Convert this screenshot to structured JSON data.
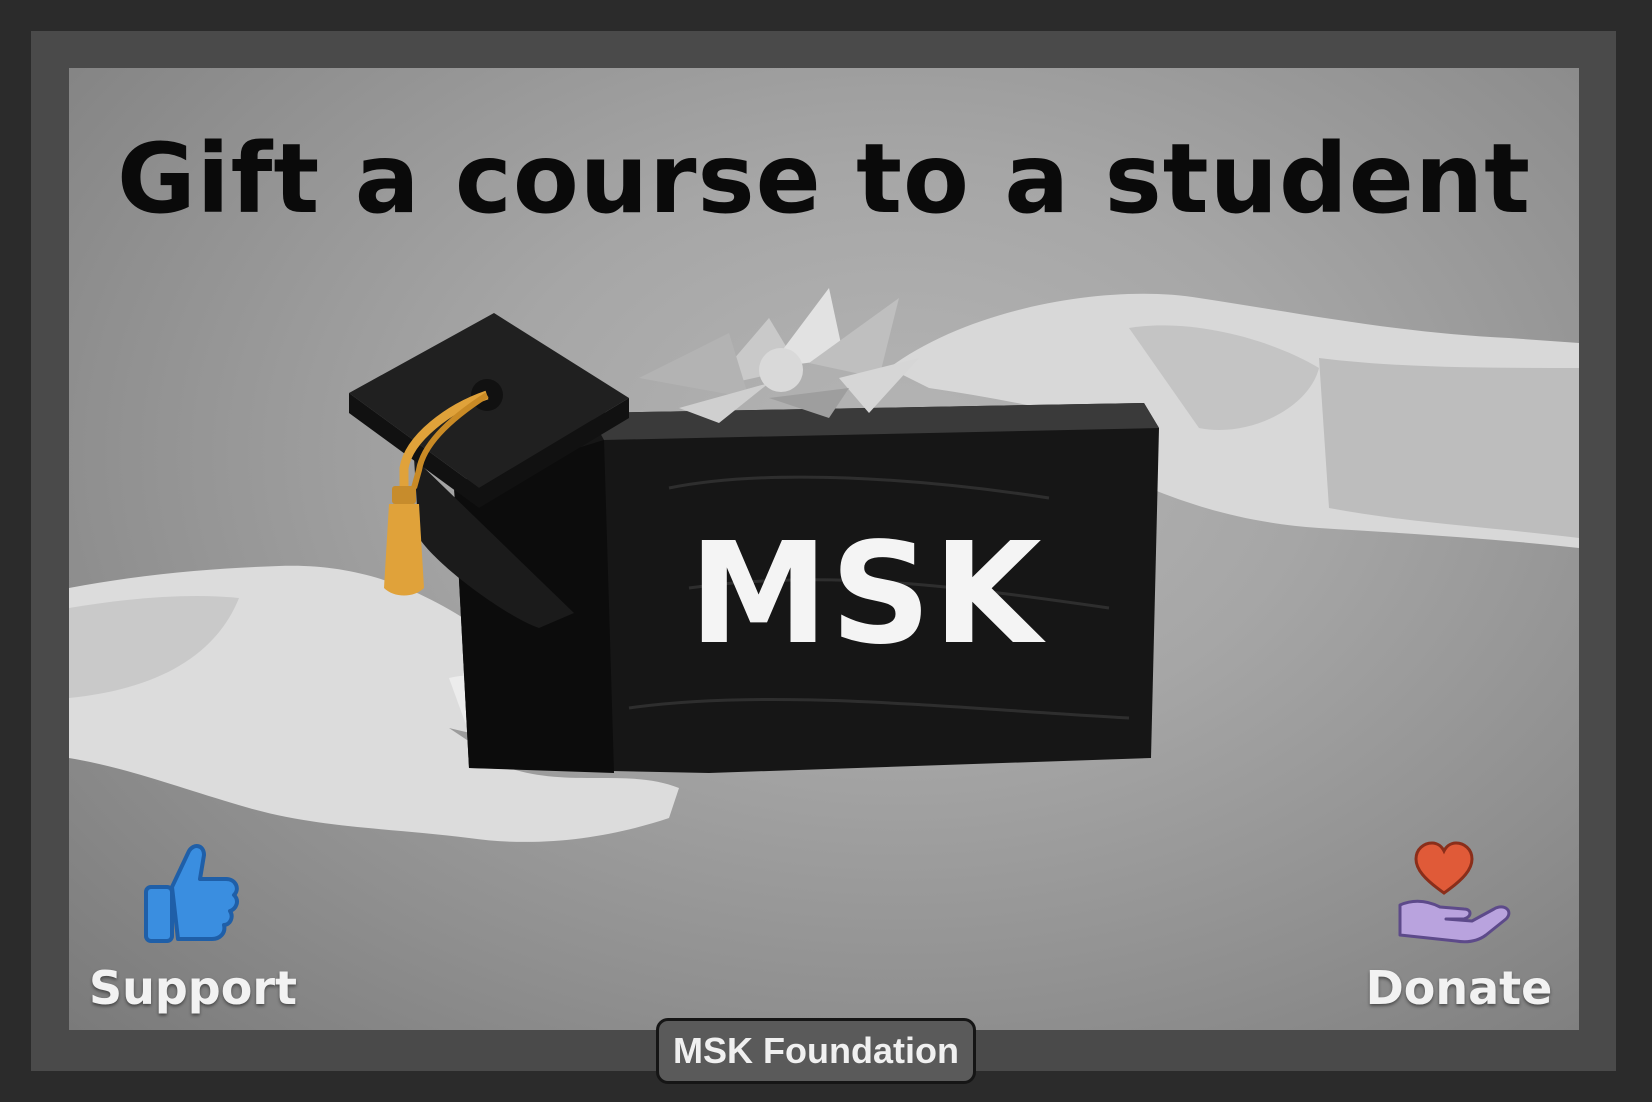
{
  "banner": {
    "title": "Gift a course to a student",
    "box_label": "MSK"
  },
  "actions": {
    "support": {
      "label": "Support",
      "icon": "thumbs-up-icon",
      "color": "#2f7fd1"
    },
    "donate": {
      "label": "Donate",
      "icon": "heart-on-hand-icon",
      "heart_color": "#e05a38",
      "hand_color": "#b39ddb"
    }
  },
  "footer": {
    "tab_label": "MSK Foundation"
  },
  "colors": {
    "background": "#2b2b2b",
    "frame": "#4a4a4a",
    "tassel": "#e0a23a"
  }
}
